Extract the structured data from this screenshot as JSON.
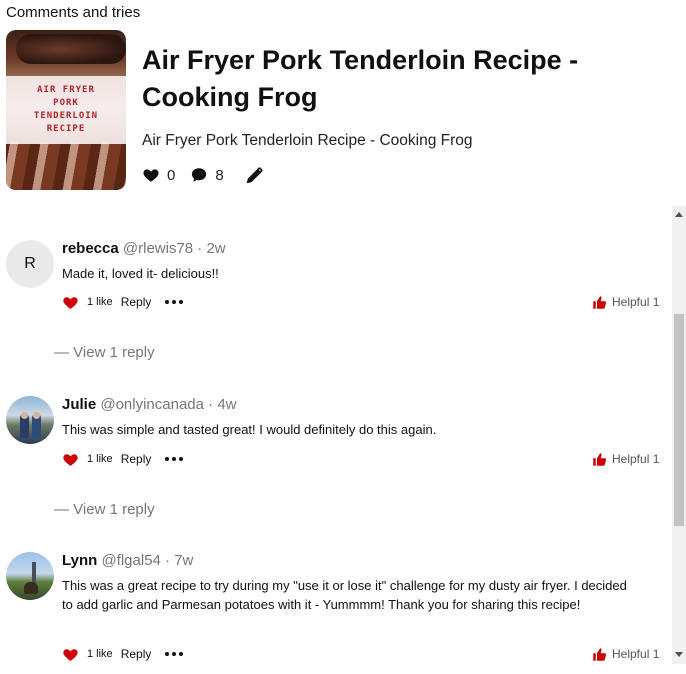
{
  "section_label": "Comments and tries",
  "pin": {
    "thumbnail_text": [
      "AIR FRYER",
      "PORK",
      "TENDERLOIN",
      "RECIPE"
    ],
    "title": "Air Fryer Pork Tenderloin Recipe - Cooking Frog",
    "subtitle": "Air Fryer Pork Tenderloin Recipe - Cooking Frog",
    "likes": "0",
    "comments": "8",
    "icons": {
      "like": "heart-icon",
      "comments": "speech-bubble-icon",
      "edit": "pencil-icon"
    }
  },
  "colors": {
    "accent_red": "#cc0000",
    "muted": "#767676",
    "scrollbar": "#c2c2c2"
  },
  "comments": [
    {
      "avatar_letter": "R",
      "name": "rebecca",
      "handle": "@rlewis78 · 2w",
      "text": "Made it, loved it- delicious!!",
      "likes": "1 like",
      "reply": "Reply",
      "helpful": "Helpful 1",
      "view_reply": "— View 1 reply"
    },
    {
      "avatar_letter": "",
      "name": "Julie",
      "handle": "@onlyincanada · 4w",
      "text": "This was simple and tasted great! I would definitely do this again.",
      "likes": "1 like",
      "reply": "Reply",
      "helpful": "Helpful 1",
      "view_reply": "— View 1 reply"
    },
    {
      "avatar_letter": "",
      "name": "Lynn",
      "handle": "@flgal54 · 7w",
      "text": "This was a great recipe to try during my \"use it or lose it\" challenge for my dusty air fryer. I decided to add garlic and Parmesan potatoes with it - Yummmm! Thank you for sharing this recipe!",
      "likes": "1 like",
      "reply": "Reply",
      "helpful": "Helpful 1"
    }
  ]
}
